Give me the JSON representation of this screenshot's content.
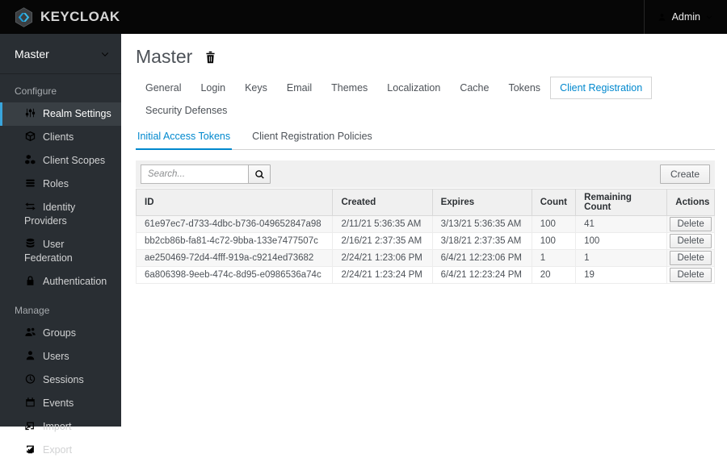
{
  "colors": {
    "accent_blue": "#0088ce",
    "active_nav_blue": "#39a5dc",
    "topbar_bg": "#060606",
    "sidebar_bg": "#292e33"
  },
  "header": {
    "brand": "KEYCLOAK",
    "user": {
      "label": "Admin"
    }
  },
  "sidebar": {
    "realm": {
      "label": "Master"
    },
    "configure": {
      "label": "Configure",
      "items": [
        {
          "label": "Realm Settings",
          "icon": "sliders-icon",
          "active": true
        },
        {
          "label": "Clients",
          "icon": "cube-icon"
        },
        {
          "label": "Client Scopes",
          "icon": "cubes-icon"
        },
        {
          "label": "Roles",
          "icon": "list-icon"
        },
        {
          "label": "Identity Providers",
          "icon": "exchange-icon"
        },
        {
          "label": "User Federation",
          "icon": "database-icon"
        },
        {
          "label": "Authentication",
          "icon": "lock-icon"
        }
      ]
    },
    "manage": {
      "label": "Manage",
      "items": [
        {
          "label": "Groups",
          "icon": "users-icon"
        },
        {
          "label": "Users",
          "icon": "user-icon"
        },
        {
          "label": "Sessions",
          "icon": "clock-icon"
        },
        {
          "label": "Events",
          "icon": "calendar-icon"
        },
        {
          "label": "Import",
          "icon": "import-icon"
        },
        {
          "label": "Export",
          "icon": "export-icon"
        }
      ]
    }
  },
  "main": {
    "title": "Master",
    "tabs": [
      {
        "label": "General"
      },
      {
        "label": "Login"
      },
      {
        "label": "Keys"
      },
      {
        "label": "Email"
      },
      {
        "label": "Themes"
      },
      {
        "label": "Localization"
      },
      {
        "label": "Cache"
      },
      {
        "label": "Tokens"
      },
      {
        "label": "Client Registration",
        "active": true
      },
      {
        "label": "Security Defenses"
      }
    ],
    "subtabs": [
      {
        "label": "Initial Access Tokens",
        "active": true
      },
      {
        "label": "Client Registration Policies"
      }
    ],
    "toolbar": {
      "search_placeholder": "Search...",
      "create_label": "Create"
    },
    "table": {
      "columns": [
        "ID",
        "Created",
        "Expires",
        "Count",
        "Remaining Count",
        "Actions"
      ],
      "rows": [
        {
          "id": "61e97ec7-d733-4dbc-b736-049652847a98",
          "created": "2/11/21 5:36:35 AM",
          "expires": "3/13/21 5:36:35 AM",
          "count": "100",
          "remaining": "41",
          "action": "Delete"
        },
        {
          "id": "bb2cb86b-fa81-4c72-9bba-133e7477507c",
          "created": "2/16/21 2:37:35 AM",
          "expires": "3/18/21 2:37:35 AM",
          "count": "100",
          "remaining": "100",
          "action": "Delete"
        },
        {
          "id": "ae250469-72d4-4fff-919a-c9214ed73682",
          "created": "2/24/21 1:23:06 PM",
          "expires": "6/4/21 12:23:06 PM",
          "count": "1",
          "remaining": "1",
          "action": "Delete"
        },
        {
          "id": "6a806398-9eeb-474c-8d95-e0986536a74c",
          "created": "2/24/21 1:23:24 PM",
          "expires": "6/4/21 12:23:24 PM",
          "count": "20",
          "remaining": "19",
          "action": "Delete"
        }
      ]
    }
  }
}
